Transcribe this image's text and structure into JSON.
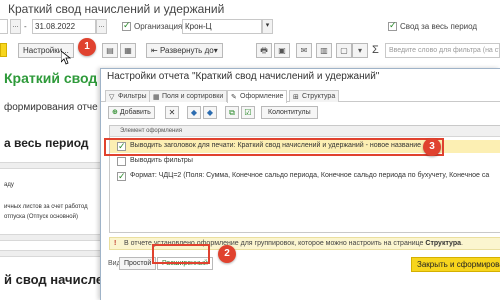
{
  "window": {
    "title": "Краткий свод начислений и удержаний"
  },
  "filters": {
    "date_to": "31.08.2022",
    "date_dots": "...",
    "org_label": "Организация:",
    "org_value": "Крон-Ц",
    "whole_period_label": "Свод за весь период"
  },
  "toolbar": {
    "settings_label": "Настройки...",
    "expand_label": "Развернуть до",
    "dropdown_arrow": "▾",
    "sum_symbol": "Σ",
    "search_placeholder": "Введите слово для фильтра (на странице"
  },
  "report": {
    "heading": "Краткий свод начи",
    "line1": "формирования отче",
    "line2": "а весь период",
    "line3": "аду",
    "line4": "ичных листов за счет работод",
    "line5": "отпуска (Отпуск основной)",
    "heading2": "й свод начислен"
  },
  "dialog": {
    "title": "Настройки отчета \"Краткий свод начислений и удержаний\"",
    "tabs": [
      {
        "label": "Фильтры",
        "icon": "filter-icon"
      },
      {
        "label": "Поля и сортировки",
        "icon": "grid-icon"
      },
      {
        "label": "Оформление",
        "icon": "brush-icon"
      },
      {
        "label": "Структура",
        "icon": "structure-icon"
      }
    ],
    "add_button": "Добавить",
    "colontitles_button": "Колонтитулы",
    "list_header": "Элемент оформления",
    "rows": [
      {
        "text": "Выводить заголовок для печати: Краткий свод начислений и удержаний  - новое название",
        "checked": true
      },
      {
        "text": "Выводить фильтры",
        "checked": false
      },
      {
        "text": "Формат: ЧДЦ=2 (Поля: Сумма, Конечное сальдо периода, Конечное сальдо периода по бухучету, Конечное са",
        "checked": true
      }
    ],
    "info_mark": "!",
    "info_text": "В отчете установлено оформление для группировок, которое можно настроить на странице ",
    "info_link": "Структура",
    "info_end": ".",
    "view_label": "Вид:",
    "simple_button": "Простой",
    "advanced_button": "Расширенный",
    "close_button": "Закрыть и сформироват"
  },
  "annotations": {
    "step1": "1",
    "step2": "2",
    "step3": "3"
  },
  "colors": {
    "accent_yellow": "#f7d51d",
    "annotation_red": "#e0422f",
    "report_green": "#2e9a3a",
    "highlight_row": "#fcefb3"
  }
}
